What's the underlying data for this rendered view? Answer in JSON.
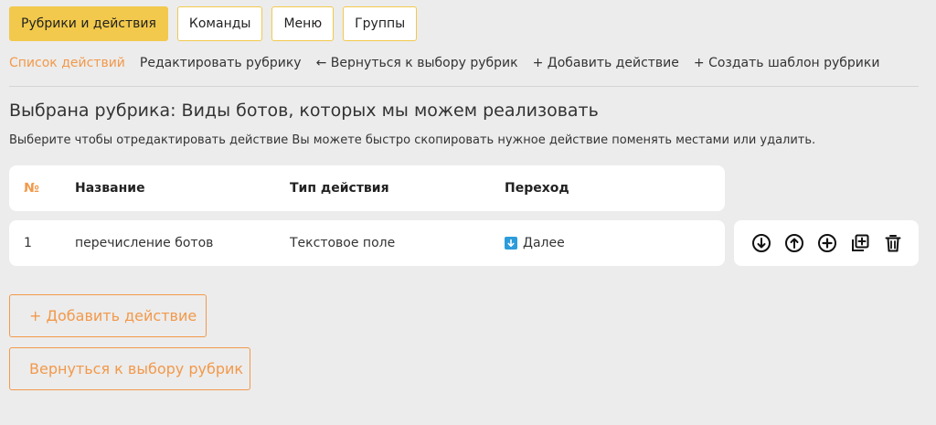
{
  "tabs": [
    {
      "label": "Рубрики и действия",
      "active": true
    },
    {
      "label": "Команды",
      "active": false
    },
    {
      "label": "Меню",
      "active": false
    },
    {
      "label": "Группы",
      "active": false
    }
  ],
  "subnav": [
    {
      "label": "Список действий",
      "active": true
    },
    {
      "label": "Редактировать рубрику",
      "active": false
    },
    {
      "label": "← Вернуться к выбору рубрик",
      "active": false
    },
    {
      "label": "+ Добавить действие",
      "active": false
    },
    {
      "label": "+ Создать шаблон рубрики",
      "active": false
    }
  ],
  "heading": "Выбрана рубрика: Виды ботов, которых мы можем реализовать",
  "hint": "Выберите чтобы отредактировать действие Вы можете быстро скопировать нужное действие поменять местами или удалить.",
  "table": {
    "headers": [
      "№",
      "Название",
      "Тип действия",
      "Переход"
    ],
    "rows": [
      {
        "num": "1",
        "name": "перечисление ботов",
        "type": "Текстовое поле",
        "goto": "Далее",
        "goto_icon": "arrow-down-square-icon"
      }
    ]
  },
  "row_actions": [
    "move-down-icon",
    "move-up-icon",
    "add-icon",
    "copy-icon",
    "delete-icon"
  ],
  "buttons": {
    "add_action": "+ Добавить действие",
    "back": "Вернуться к выбору рубрик"
  },
  "colors": {
    "accent_yellow": "#f2c94c",
    "accent_orange": "#f2994a",
    "info_blue": "#2d9cdb",
    "background": "#ececec"
  }
}
